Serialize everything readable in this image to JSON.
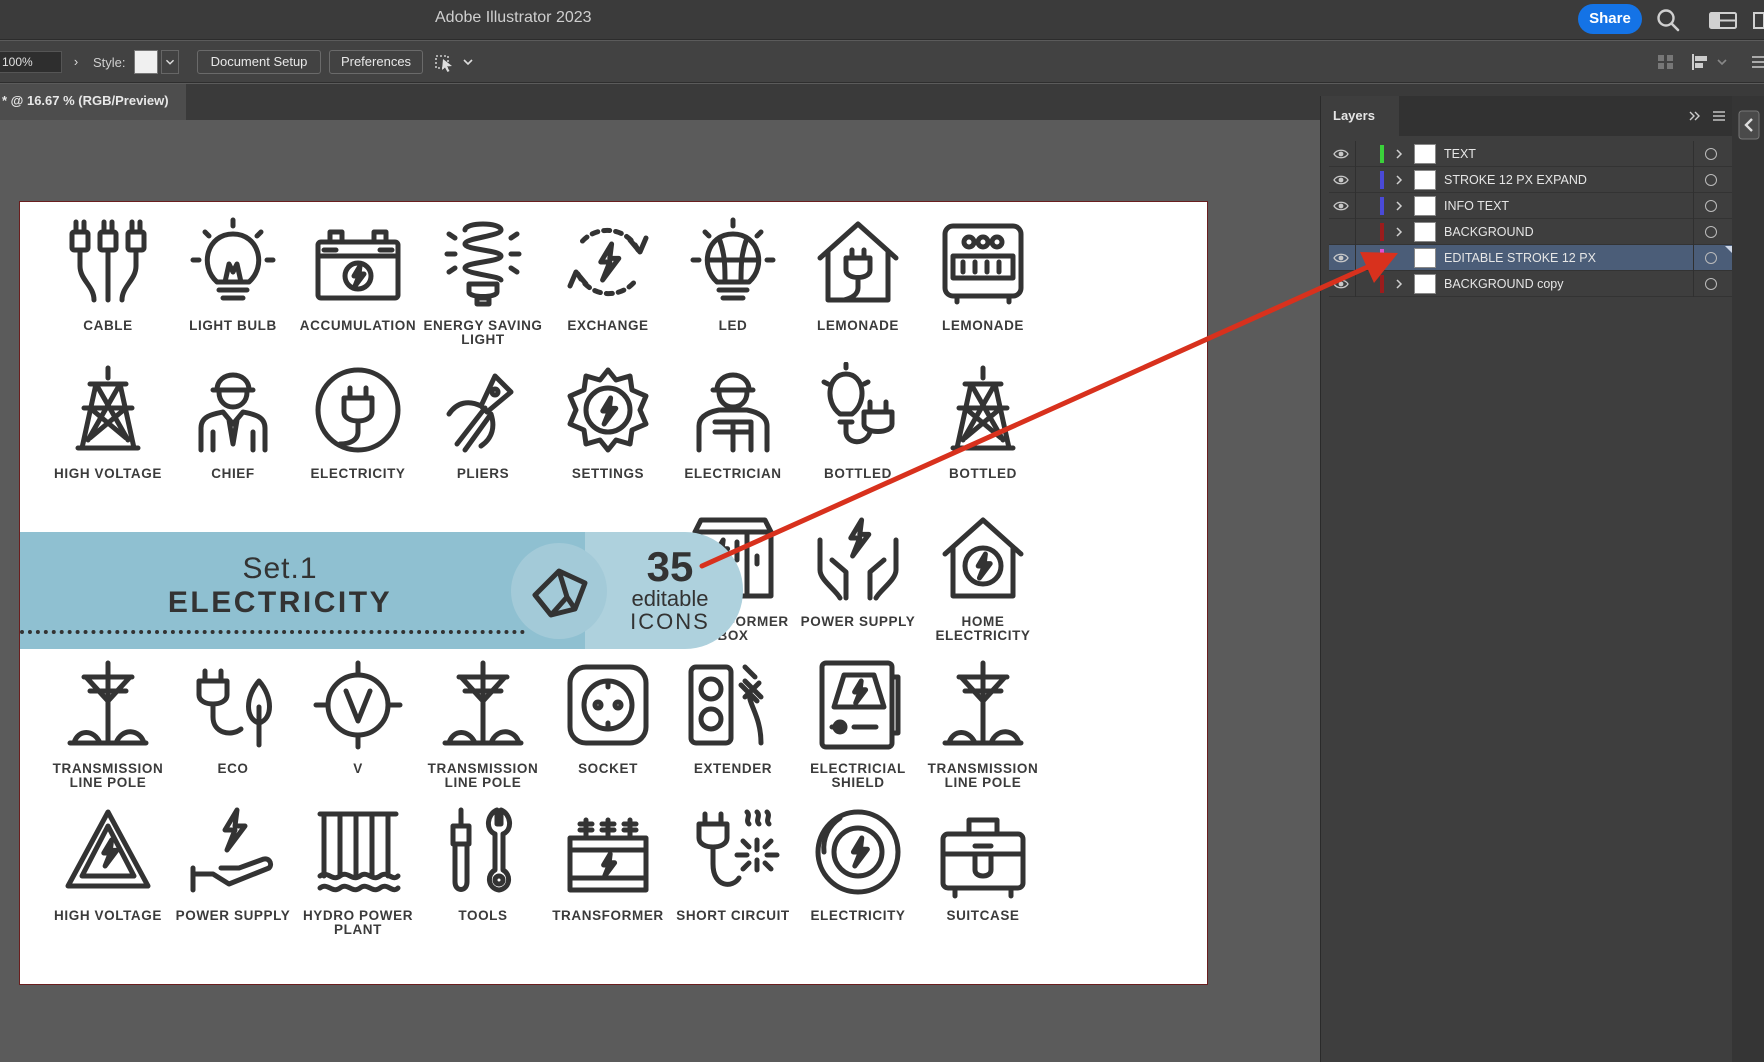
{
  "app": {
    "title": "Adobe Illustrator 2023",
    "share_label": "Share"
  },
  "controlbar": {
    "zoom_value": "100%",
    "style_label": "Style:",
    "document_setup_label": "Document Setup",
    "preferences_label": "Preferences"
  },
  "document_tab": {
    "label": "* @ 16.67 % (RGB/Preview)"
  },
  "banner": {
    "set_label": "Set.1",
    "title": "ELECTRICITY",
    "count": "35",
    "editable_label": "editable",
    "icons_label": "ICONS"
  },
  "icon_grid": [
    [
      {
        "label": "CABLE",
        "icon": "cable-icon"
      },
      {
        "label": "LIGHT BULB",
        "icon": "light-bulb-icon"
      },
      {
        "label": "ACCUMULATION",
        "icon": "battery-icon"
      },
      {
        "label": "ENERGY SAVING LIGHT",
        "icon": "energy-saving-bulb-icon"
      },
      {
        "label": "EXCHANGE",
        "icon": "exchange-icon"
      },
      {
        "label": "LED",
        "icon": "led-bulb-icon"
      },
      {
        "label": "LEMONADE",
        "icon": "house-plug-icon"
      },
      {
        "label": "LEMONADE",
        "icon": "meter-icon"
      }
    ],
    [
      {
        "label": "HIGH VOLTAGE",
        "icon": "power-tower-icon"
      },
      {
        "label": "CHIEF",
        "icon": "chief-icon"
      },
      {
        "label": "ELECTRICITY",
        "icon": "plug-circle-icon"
      },
      {
        "label": "PLIERS",
        "icon": "pliers-icon"
      },
      {
        "label": "SETTINGS",
        "icon": "gear-bolt-icon"
      },
      {
        "label": "ELECTRICIAN",
        "icon": "electrician-icon"
      },
      {
        "label": "BOTTLED",
        "icon": "bulb-plug-icon"
      },
      {
        "label": "BOTTLED",
        "icon": "pylon-icon"
      }
    ],
    [
      {
        "label": "TRANSFORMER BOX",
        "icon": "transformer-box-icon"
      },
      {
        "label": "POWER SUPPLY",
        "icon": "hands-bolt-icon"
      },
      {
        "label": "HOME ELECTRICITY",
        "icon": "home-bolt-icon"
      }
    ],
    [
      {
        "label": "TRANSMISSION LINE POLE",
        "icon": "line-pole-icon"
      },
      {
        "label": "ECO",
        "icon": "eco-plug-icon"
      },
      {
        "label": "V",
        "icon": "voltage-icon"
      },
      {
        "label": "TRANSMISSION LINE POLE",
        "icon": "line-pole-icon"
      },
      {
        "label": "SOCKET",
        "icon": "socket-icon"
      },
      {
        "label": "EXTENDER",
        "icon": "extender-icon"
      },
      {
        "label": "ELECTRICIAL SHIELD",
        "icon": "electrical-shield-icon"
      },
      {
        "label": "TRANSMISSION LINE POLE",
        "icon": "line-pole-icon"
      }
    ],
    [
      {
        "label": "HIGH VOLTAGE",
        "icon": "warning-bolt-icon"
      },
      {
        "label": "POWER SUPPLY",
        "icon": "hand-bolt-icon"
      },
      {
        "label": "HYDRO POWER PLANT",
        "icon": "hydro-plant-icon"
      },
      {
        "label": "TOOLS",
        "icon": "tools-icon"
      },
      {
        "label": "TRANSFORMER",
        "icon": "transformer-icon"
      },
      {
        "label": "SHORT CIRCUIT",
        "icon": "short-circuit-icon"
      },
      {
        "label": "ELECTRICITY",
        "icon": "bolt-circle-icon"
      },
      {
        "label": "SUITCASE",
        "icon": "toolbox-icon"
      }
    ]
  ],
  "layers_panel": {
    "title": "Layers",
    "layers": [
      {
        "name": "TEXT",
        "color": "#3ad13a",
        "visible": true,
        "expandable": true,
        "selected": false
      },
      {
        "name": "STROKE 12 PX EXPAND",
        "color": "#4a4ad8",
        "visible": true,
        "expandable": true,
        "selected": false
      },
      {
        "name": "INFO TEXT",
        "color": "#4a4ad8",
        "visible": true,
        "expandable": true,
        "selected": false
      },
      {
        "name": "BACKGROUND",
        "color": "#9b1c1c",
        "visible": false,
        "expandable": true,
        "selected": false
      },
      {
        "name": "EDITABLE STROKE 12 PX",
        "color": "#e04fd0",
        "visible": true,
        "expandable": false,
        "selected": true
      },
      {
        "name": "BACKGROUND copy",
        "color": "#9b1c1c",
        "visible": true,
        "expandable": true,
        "selected": false
      }
    ]
  },
  "annotation": {
    "arrow_color": "#d8311d"
  }
}
